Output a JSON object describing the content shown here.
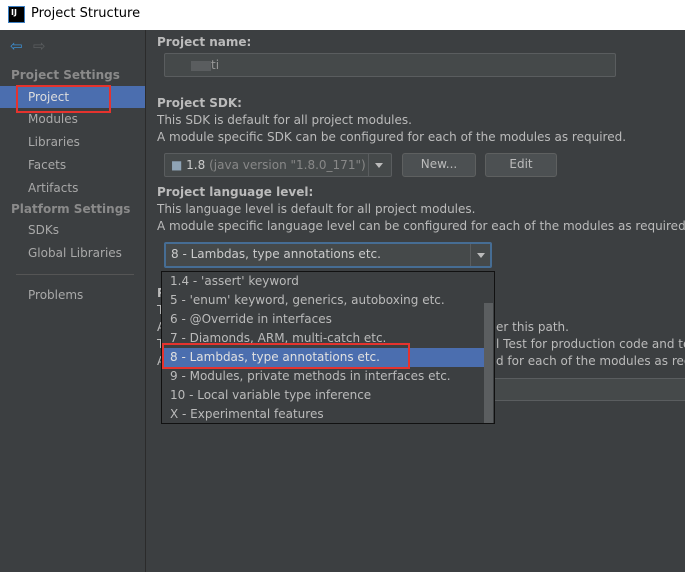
{
  "window": {
    "title": "Project Structure",
    "app_icon": "IJ"
  },
  "sidebar": {
    "sections": [
      {
        "label": "Project Settings",
        "items": [
          "Project",
          "Modules",
          "Libraries",
          "Facets",
          "Artifacts"
        ]
      },
      {
        "label": "Platform Settings",
        "items": [
          "SDKs",
          "Global Libraries"
        ]
      }
    ],
    "extra": "Problems",
    "selected": "Project"
  },
  "main": {
    "name_label": "Project name:",
    "name_value": "ti",
    "sdk_label": "Project SDK:",
    "sdk_desc1": "This SDK is default for all project modules.",
    "sdk_desc2": "A module specific SDK can be configured for each of the modules as required.",
    "sdk_value": "1.8",
    "sdk_detail": "(java version \"1.8.0_171\")",
    "new_button": "New...",
    "edit_button": "Edit",
    "lang_label": "Project language level:",
    "lang_desc1": "This language level is default for all project modules.",
    "lang_desc2": "A module specific language level can be configured for each of the modules as required.",
    "lang_value": "8 - Lambdas, type annotations etc.",
    "hidden": {
      "p": "P",
      "t1": "T",
      "a1": "A",
      "t2": "T",
      "a2": "A",
      "frag1": "er this path.",
      "frag2": "l Test for production code and te",
      "frag3": "d for each of the modules as requ"
    }
  },
  "dropdown": {
    "options": [
      "1.4 - 'assert' keyword",
      "5 - 'enum' keyword, generics, autoboxing etc.",
      "6 - @Override in interfaces",
      "7 - Diamonds, ARM, multi-catch etc.",
      "8 - Lambdas, type annotations etc.",
      "9 - Modules, private methods in interfaces etc.",
      "10 - Local variable type inference",
      "X - Experimental features"
    ],
    "selected_index": 4
  },
  "colors": {
    "selection": "#4b6eaf",
    "highlight_box": "#e5332e",
    "background": "#3c3f41"
  }
}
